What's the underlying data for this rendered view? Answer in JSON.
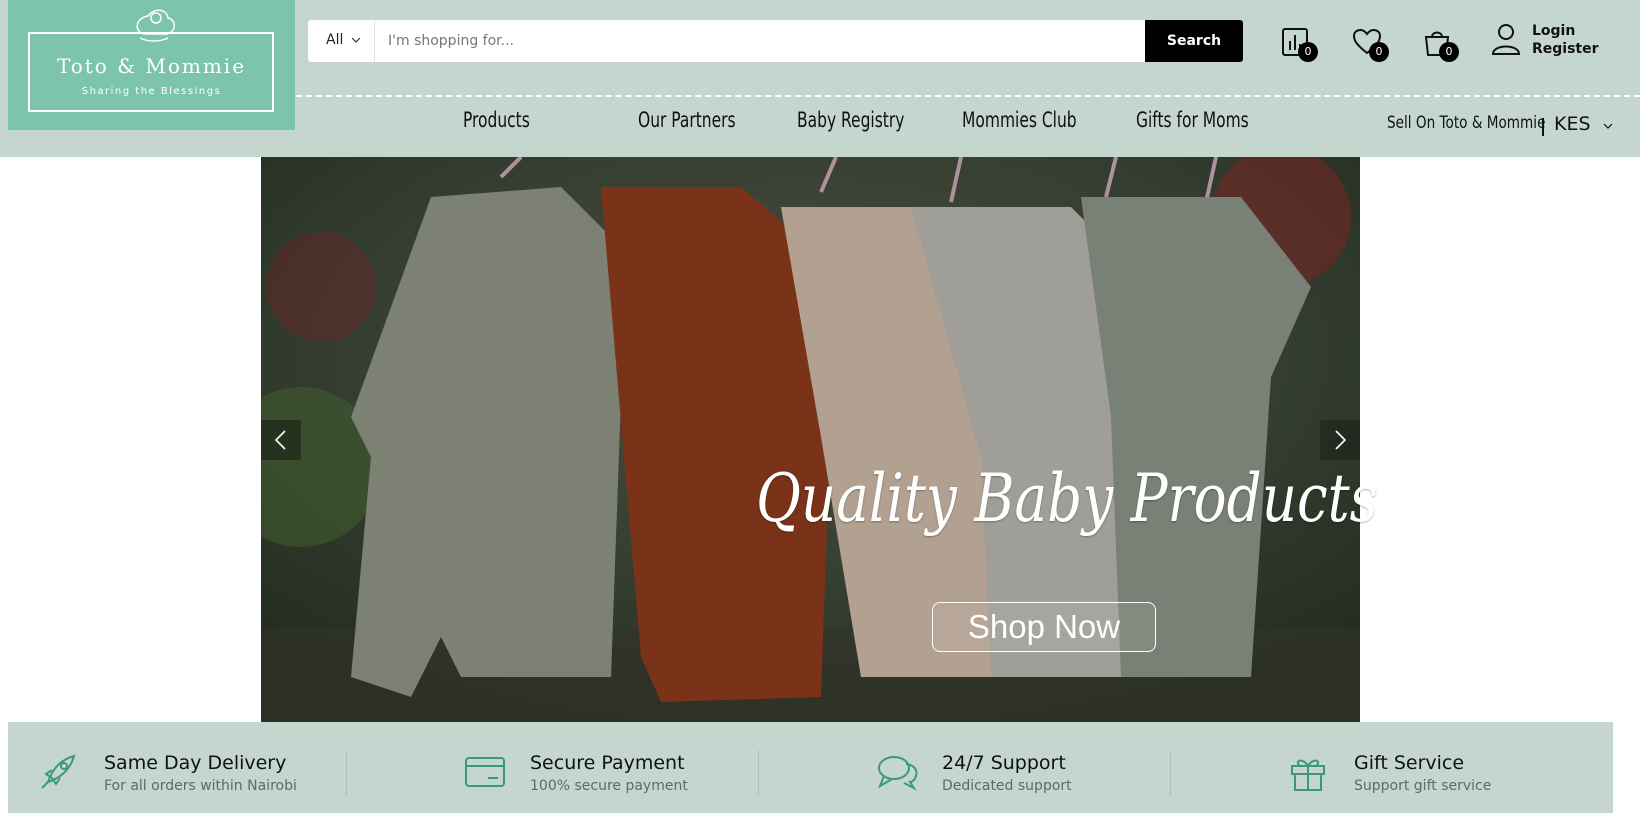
{
  "brand": {
    "name": "Toto & Mommie",
    "tagline": "Sharing the Blessings",
    "color": "#7cc5ac"
  },
  "search": {
    "category": "All",
    "placeholder": "I'm shopping for...",
    "button": "Search"
  },
  "header_icons": [
    {
      "icon": "compare-chart-icon",
      "count": "0"
    },
    {
      "icon": "heart-icon",
      "count": "0"
    },
    {
      "icon": "shopping-bag-icon",
      "count": "0"
    }
  ],
  "account": {
    "icon": "user-icon",
    "login": "Login",
    "register": "Register"
  },
  "nav": [
    "Products",
    "Our Partners",
    "Baby Registry",
    "Mommies Club",
    "Gifts for Moms"
  ],
  "sell_link": "Sell On Toto & Mommie",
  "currency": "KES",
  "hero": {
    "title": "Quality Baby Products",
    "button": "Shop Now",
    "prev_icon": "chevron-left-icon",
    "next_icon": "chevron-right-icon"
  },
  "features": [
    {
      "icon": "rocket-icon",
      "title": "Same Day Delivery",
      "subtitle": "For all orders within Nairobi"
    },
    {
      "icon": "credit-card-icon",
      "title": "Secure Payment",
      "subtitle": "100% secure payment"
    },
    {
      "icon": "chat-bubbles-icon",
      "title": "24/7 Support",
      "subtitle": "Dedicated support"
    },
    {
      "icon": "gift-icon",
      "title": "Gift Service",
      "subtitle": "Support gift service"
    }
  ],
  "colors": {
    "header_bg": "#c5d6ce",
    "accent": "#3a9a78",
    "search_button": "#000000"
  }
}
